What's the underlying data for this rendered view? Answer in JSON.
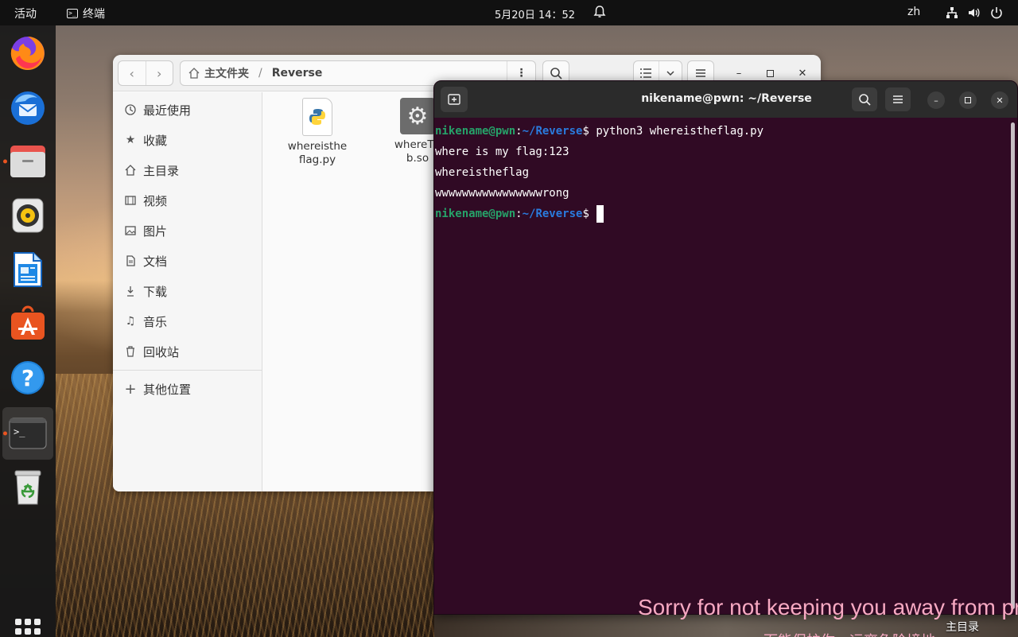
{
  "topbar": {
    "activities": "活动",
    "app_name": "终端",
    "clock": "5月20日 14：52",
    "lang": "zh"
  },
  "dock": {
    "items": [
      "firefox",
      "thunderbird",
      "files",
      "rhythmbox",
      "libreoffice-writer",
      "app-center",
      "help",
      "terminal",
      "trash"
    ],
    "accent": "#e95420"
  },
  "files": {
    "path": {
      "home": "主文件夹",
      "current": "Reverse"
    },
    "sidebar": [
      {
        "label": "最近使用",
        "icon": "clock-icon"
      },
      {
        "label": "收藏",
        "icon": "star-icon"
      },
      {
        "label": "主目录",
        "icon": "home-icon"
      },
      {
        "label": "视频",
        "icon": "video-icon"
      },
      {
        "label": "图片",
        "icon": "image-icon"
      },
      {
        "label": "文档",
        "icon": "document-icon"
      },
      {
        "label": "下载",
        "icon": "download-icon"
      },
      {
        "label": "音乐",
        "icon": "music-icon"
      },
      {
        "label": "回收站",
        "icon": "trash-icon"
      },
      {
        "label": "其他位置",
        "icon": "plus-icon"
      }
    ],
    "items": [
      {
        "line1": "whereisthe",
        "line2": "flag.py",
        "icon": "python-file-icon"
      },
      {
        "line1": "whereTh",
        "line2": "b.so",
        "icon": "shared-library-icon"
      }
    ]
  },
  "terminal": {
    "title": "nikename@pwn: ~/Reverse",
    "prompt_user": "nikename@pwn",
    "prompt_colon": ":",
    "prompt_path": "~/Reverse",
    "prompt_dollar": "$",
    "command": " python3 whereistheflag.py",
    "output": [
      "where is my flag:123",
      "whereistheflag",
      "wwwwwwwwwwwwwwwwrong"
    ],
    "colors": {
      "background": "#300a24",
      "user": "#26a269",
      "path": "#2a7bde"
    }
  },
  "overlay": {
    "subtitle": "Sorry for not keeping you away from pro",
    "subtitle_partial": "而能保护你，远离危险境地",
    "desktop_home": "主目录"
  }
}
